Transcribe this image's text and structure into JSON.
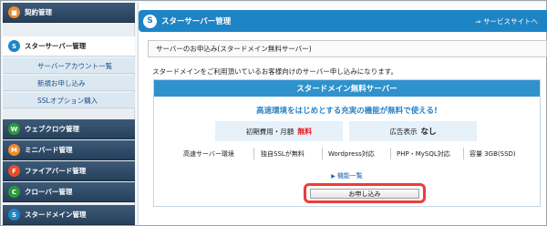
{
  "sidebar": {
    "items": [
      {
        "label": "契約管理",
        "icon": "document-icon",
        "color": "#f08a2a",
        "glyph": "■"
      },
      {
        "label": "スターサーバー管理",
        "icon": "star-server-icon",
        "color": "#1d84c6",
        "glyph": "S",
        "active": true
      },
      {
        "label": "ウェブクロウ管理",
        "icon": "webcrow-icon",
        "color": "#2b9a3a",
        "glyph": "W"
      },
      {
        "label": "ミニバード管理",
        "icon": "minibird-icon",
        "color": "#f08a2a",
        "glyph": "M"
      },
      {
        "label": "ファイアバード管理",
        "icon": "firebird-icon",
        "color": "#e94b2a",
        "glyph": "F"
      },
      {
        "label": "クローバー管理",
        "icon": "clover-icon",
        "color": "#2b9a3a",
        "glyph": "C"
      },
      {
        "label": "スタードメイン管理",
        "icon": "star-domain-icon",
        "color": "#1d84c6",
        "glyph": "S"
      }
    ],
    "sub_items": [
      {
        "label": "サーバーアカウント一覧"
      },
      {
        "label": "新規お申し込み"
      },
      {
        "label": "SSLオプション購入"
      }
    ]
  },
  "header": {
    "title": "スターサーバー管理",
    "link": "⇒ サービスサイトへ"
  },
  "breadcrumb": "サーバーのお申込み(スタードメイン無料サーバー)",
  "intro": "スタードメインをご利用頂いているお客様向けのサーバー申し込みになります。",
  "plan": {
    "title": "スタードメイン無料サーバー",
    "tagline": "高速環境をはじめとする充実の機能が無料で使える!",
    "fee_label": "初期費用・月額",
    "fee_value": "無料",
    "ad_label": "広告表示",
    "ad_value": "なし",
    "features": [
      "高速サーバー環境",
      "独自SSLが無料",
      "Wordpress対応",
      "PHP・MySQL対応",
      "容量 3GB(SSD)"
    ],
    "feature_link": "機能一覧",
    "apply_button": "お申し込み"
  }
}
